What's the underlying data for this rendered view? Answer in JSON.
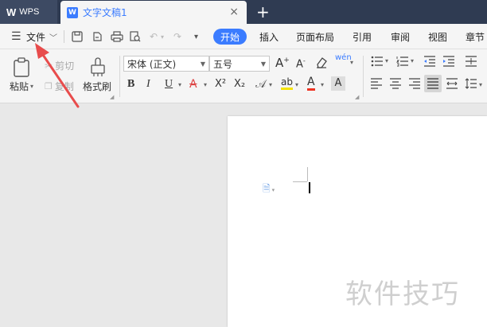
{
  "titlebar": {
    "app_label": "WPS",
    "doc_tab_label": "文字文稿1",
    "close_glyph": "×",
    "newtab_glyph": "+"
  },
  "menubar": {
    "file_label": "文件",
    "tabs": [
      "开始",
      "插入",
      "页面布局",
      "引用",
      "审阅",
      "视图",
      "章节"
    ]
  },
  "ribbon": {
    "paste_label": "粘贴",
    "cut_label": "剪切",
    "copy_label": "复制",
    "format_painter_label": "格式刷",
    "font_name": "宋体 (正文)",
    "font_size": "五号",
    "bold": "B",
    "italic": "I",
    "underline": "U",
    "strike": "A",
    "superscript": "X²",
    "subscript": "X₂",
    "grow_font": "A⁺",
    "shrink_font": "A⁻",
    "pinyin": "wén"
  },
  "watermark_text": "软件技巧",
  "colors": {
    "titlebar_bg": "#2f3b52",
    "accent": "#3b7cff",
    "arrow": "#e84c4c"
  }
}
